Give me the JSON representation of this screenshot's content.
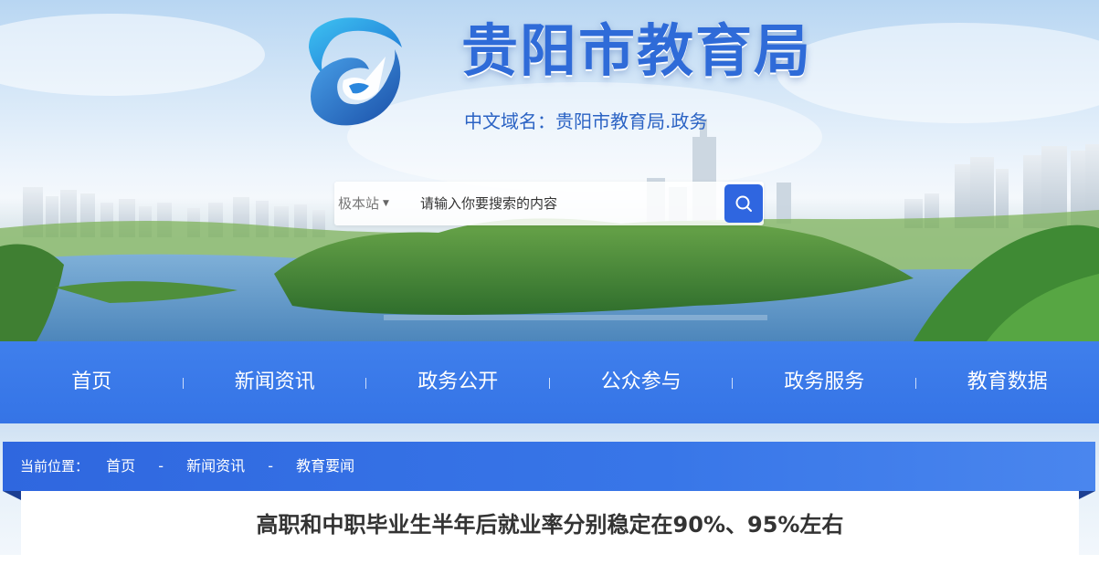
{
  "header": {
    "site_title": "贵阳市教育局",
    "domain_line": "中文域名：贵阳市教育局.政务"
  },
  "search": {
    "scope_label": "极本站",
    "placeholder": "请输入你要搜索的内容"
  },
  "nav": {
    "items": [
      {
        "label": "首页"
      },
      {
        "label": "新闻资讯"
      },
      {
        "label": "政务公开"
      },
      {
        "label": "公众参与"
      },
      {
        "label": "政务服务"
      },
      {
        "label": "教育数据"
      }
    ]
  },
  "breadcrumb": {
    "label": "当前位置：",
    "items": [
      "首页",
      "新闻资讯",
      "教育要闻"
    ],
    "separator": "-"
  },
  "article": {
    "title": "高职和中职毕业生半年后就业率分别稳定在90%、95%左右"
  },
  "colors": {
    "nav_blue": "#3574e6",
    "title_blue": "#2f6bd8",
    "search_button": "#2f66e0"
  }
}
